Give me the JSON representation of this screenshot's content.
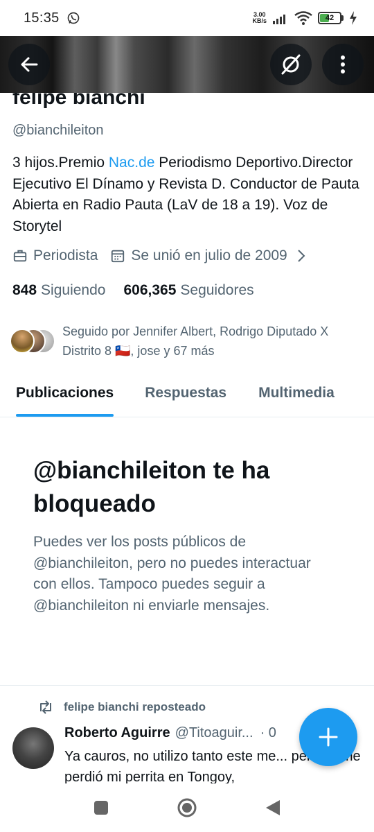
{
  "status_bar": {
    "time": "15:35",
    "net_speed_value": "3.00",
    "net_speed_unit": "KB/s",
    "battery": "42",
    "icons": [
      "whatsapp-icon",
      "signal-icon",
      "wifi-icon",
      "battery-icon",
      "charging-icon"
    ]
  },
  "header": {
    "back_icon": "arrow-left-icon",
    "grok_icon": "grok-icon",
    "more_icon": "more-vertical-icon"
  },
  "profile": {
    "name": "felipe bianchi",
    "handle": "@bianchileiton",
    "bio_before": "3 hijos.Premio ",
    "bio_link": "Nac.de",
    "bio_after": " Periodismo Deportivo.Director Ejecutivo El Dínamo y Revista D. Conductor de Pauta Abierta en Radio Pauta (LaV de 18 a 19). Voz de Storytel",
    "profession": "Periodista",
    "joined": "Se unió en julio de 2009",
    "following_count": "848",
    "following_label": "Siguiendo",
    "followers_count": "606,365",
    "followers_label": "Seguidores",
    "followed_by": "Seguido por Jennifer Albert, Rodrigo Diputado X Distrito 8 🇨🇱, jose y 67 más"
  },
  "tabs": [
    {
      "label": "Publicaciones",
      "active": true
    },
    {
      "label": "Respuestas",
      "active": false
    },
    {
      "label": "Multimedia",
      "active": false
    }
  ],
  "blocked": {
    "title": "@bianchileiton te ha bloqueado",
    "description": "Puedes ver los posts públicos de @bianchileiton, pero no puedes interactuar con ellos. Tampoco puedes seguir a @bianchileiton ni enviarle mensajes."
  },
  "tweet": {
    "repost_label": "felipe bianchi reposteado",
    "author_name": "Roberto Aguirre",
    "author_handle": "@Titoaguir...",
    "time_sep": "· 0",
    "text": "Ya cauros, no utilizo tanto este me... pero se me perdió mi perrita en Tongoy,"
  },
  "fab_icon": "plus-icon",
  "navbar": {
    "icons": [
      "recents-square-icon",
      "home-circle-icon",
      "back-triangle-icon"
    ]
  },
  "colors": {
    "accent": "#1d9bf0",
    "text_primary": "#0f1419",
    "text_secondary": "#536471"
  }
}
